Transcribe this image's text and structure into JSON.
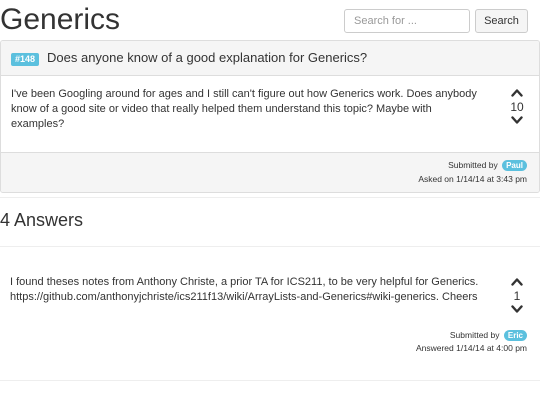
{
  "page": {
    "title": "Generics"
  },
  "search": {
    "placeholder": "Search for ...",
    "button_label": "Search"
  },
  "question": {
    "id_badge": "#148",
    "title": "Does anyone know of a good explanation for Generics?",
    "body": "I've been Googling around for ages and I still can't figure out how Generics work. Does anybody know of a good site or video that really helped them understand this topic? Maybe with examples?",
    "votes": "10",
    "submitted_label": "Submitted by",
    "author": "Paul",
    "asked_on": "Asked on 1/14/14 at 3:43 pm"
  },
  "answers": {
    "heading": "4 Answers",
    "items": [
      {
        "body": "I found theses notes from Anthony Christe, a prior TA for ICS211, to be very helpful for Generics. https://github.com/anthonyjchriste/ics211f13/wiki/ArrayLists-and-Generics#wiki-generics. Cheers",
        "votes": "1",
        "submitted_label": "Submitted by",
        "author": "Eric",
        "answered_on": "Answered 1/14/14 at 4:00 pm"
      }
    ]
  },
  "icons": {
    "upvote": "chevron-up-icon",
    "downvote": "chevron-down-icon"
  },
  "colors": {
    "badge": "#5bc0de",
    "panel_bg": "#f5f5f5",
    "border": "#dddddd"
  }
}
